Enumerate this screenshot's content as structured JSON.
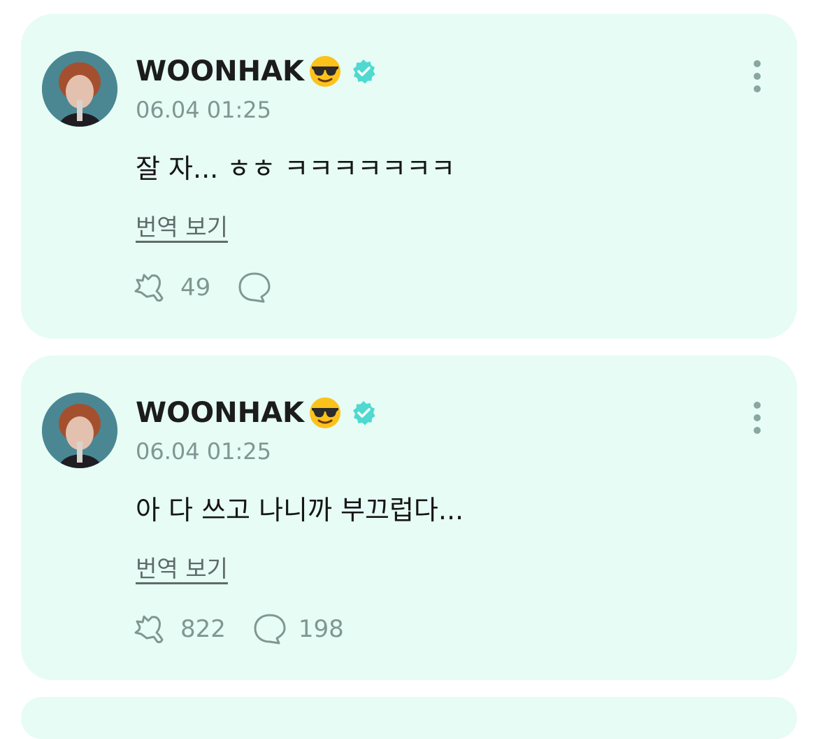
{
  "posts": [
    {
      "author": "WOONHAK",
      "emoji": "sunglasses-emoji",
      "verified": true,
      "time": "06.04 01:25",
      "text": "잘 자... ㅎㅎ ㅋㅋㅋㅋㅋㅋㅋ",
      "translate_label": "번역 보기",
      "likes": "49",
      "comments": ""
    },
    {
      "author": "WOONHAK",
      "emoji": "sunglasses-emoji",
      "verified": true,
      "time": "06.04 01:25",
      "text": "아 다 쓰고 나니까 부끄럽다...",
      "translate_label": "번역 보기",
      "likes": "822",
      "comments": "198"
    }
  ],
  "colors": {
    "card_bg": "#e6fcf5",
    "badge": "#4fd9d0",
    "muted": "#7f9793"
  }
}
